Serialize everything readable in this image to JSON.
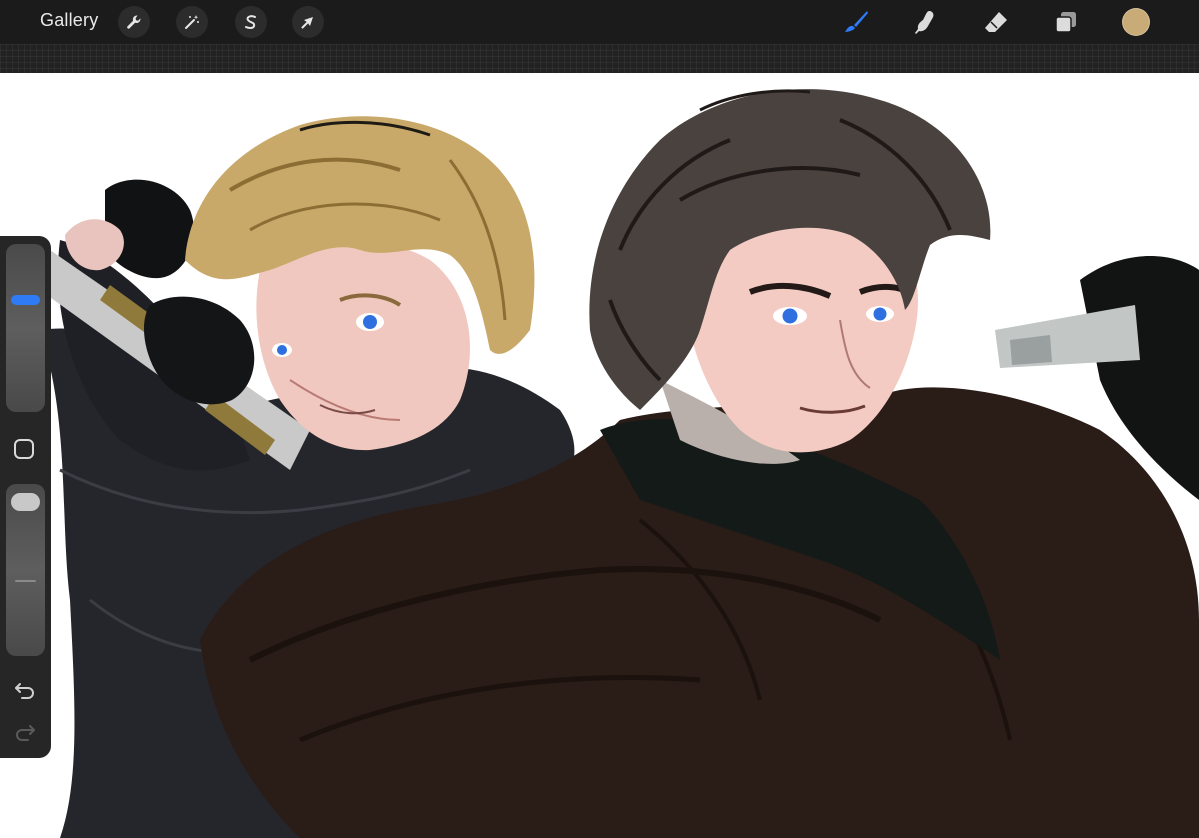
{
  "topbar": {
    "gallery_label": "Gallery",
    "left_tools": [
      {
        "name": "actions",
        "icon": "wrench-icon"
      },
      {
        "name": "adjustments",
        "icon": "magic-wand-icon"
      },
      {
        "name": "selection",
        "icon": "selection-s-icon"
      },
      {
        "name": "transform",
        "icon": "arrow-cursor-icon"
      }
    ],
    "right_tools": [
      {
        "name": "brush",
        "icon": "brush-icon",
        "active": true
      },
      {
        "name": "smudge",
        "icon": "smudge-finger-icon",
        "active": false
      },
      {
        "name": "eraser",
        "icon": "eraser-icon",
        "active": false
      },
      {
        "name": "layers",
        "icon": "layers-icon",
        "active": false
      }
    ],
    "current_color": "#c9ab78",
    "accent_color": "#2f7bf6"
  },
  "sidebar": {
    "brush_size_level": 0.3,
    "opacity_level": 0.05,
    "modifier_icon": "square-modifier-icon",
    "undo_icon": "undo-icon",
    "redo_icon": "redo-icon"
  },
  "canvas": {
    "artwork": "digital-painting-two-figures"
  }
}
